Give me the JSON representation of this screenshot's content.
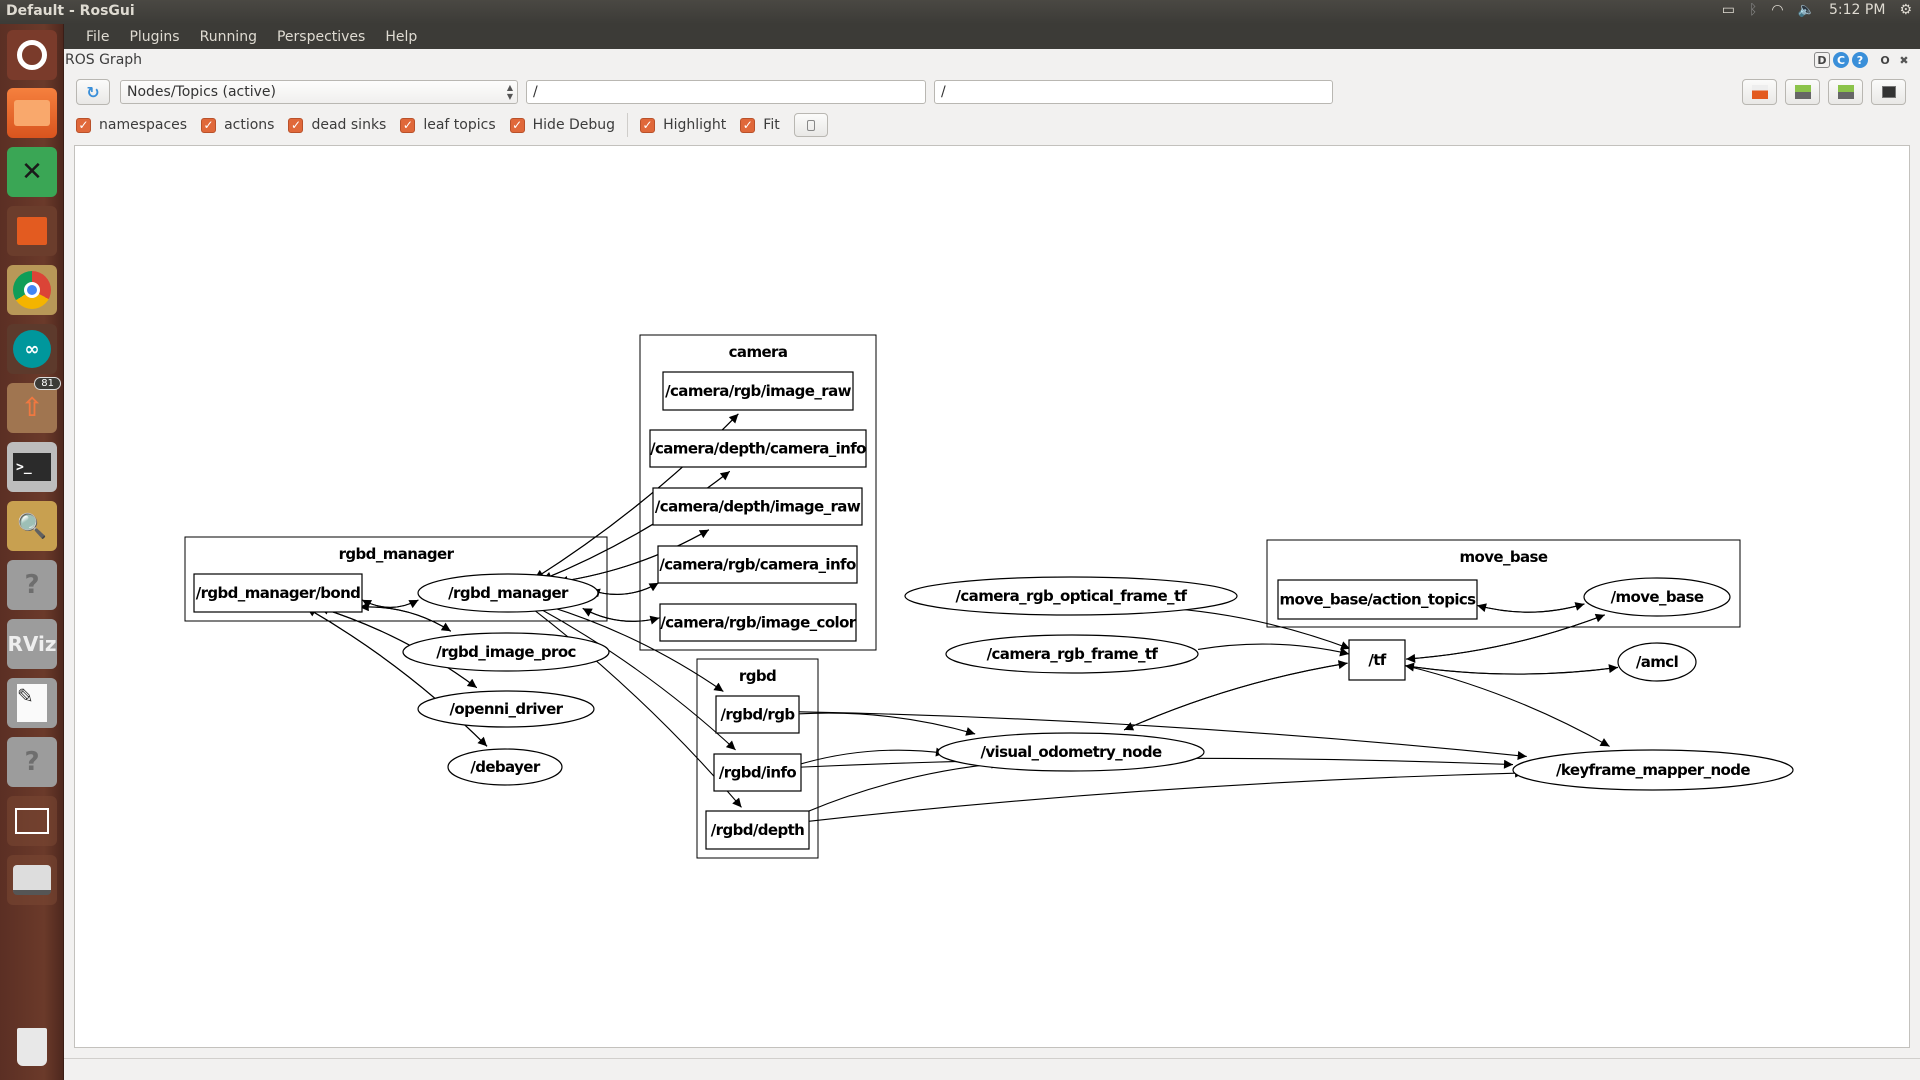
{
  "window": {
    "title": "Default - RosGui"
  },
  "tray": {
    "battery_icon": "battery-charging-icon",
    "bluetooth_icon": "bluetooth-icon",
    "wifi_icon": "wifi-icon",
    "volume_icon": "volume-icon",
    "time": "5:12 PM",
    "power_icon": "power-gear-icon"
  },
  "menu": {
    "items": [
      "File",
      "Plugins",
      "Running",
      "Perspectives",
      "Help"
    ]
  },
  "launcher": {
    "items": [
      {
        "name": "ubuntu-dash",
        "icon": "ubuntu-logo-icon"
      },
      {
        "name": "files",
        "icon": "folder-icon"
      },
      {
        "name": "system-tools",
        "icon": "tools-icon"
      },
      {
        "name": "software-center",
        "icon": "shopping-bag-icon"
      },
      {
        "name": "chrome",
        "icon": "chrome-icon"
      },
      {
        "name": "arduino",
        "icon": "arduino-icon"
      },
      {
        "name": "software-updater",
        "icon": "update-box-icon",
        "badge": "81"
      },
      {
        "name": "terminal",
        "icon": "terminal-icon"
      },
      {
        "name": "image-viewer",
        "icon": "image-viewer-icon"
      },
      {
        "name": "unknown-app-1",
        "icon": "question-icon"
      },
      {
        "name": "rviz",
        "icon": "rviz-icon",
        "label": "RViz"
      },
      {
        "name": "text-editor",
        "icon": "text-editor-icon"
      },
      {
        "name": "unknown-app-2",
        "icon": "question-icon"
      },
      {
        "name": "workspace-switcher",
        "icon": "workspace-icon"
      },
      {
        "name": "drive",
        "icon": "hard-drive-icon"
      },
      {
        "name": "trash",
        "icon": "trash-icon"
      }
    ]
  },
  "plugin": {
    "title": "ROS Graph",
    "controls": [
      "D",
      "C",
      "?",
      "O",
      "✖"
    ]
  },
  "toolbar": {
    "graph_type": "Nodes/Topics (active)",
    "node_filter": "/",
    "topic_filter": "/",
    "right_buttons": [
      "load-dot-icon",
      "save-dot-icon",
      "save-svg-icon",
      "save-image-icon"
    ]
  },
  "options": [
    {
      "label": "namespaces",
      "checked": true
    },
    {
      "label": "actions",
      "checked": true
    },
    {
      "label": "dead sinks",
      "checked": true
    },
    {
      "label": "leaf topics",
      "checked": true
    },
    {
      "label": "Hide Debug",
      "checked": true
    },
    {
      "label": "Highlight",
      "checked": true
    },
    {
      "label": "Fit",
      "checked": true
    }
  ],
  "graph": {
    "clusters": [
      {
        "id": "rgbd_manager",
        "label": "rgbd_manager"
      },
      {
        "id": "camera",
        "label": "camera"
      },
      {
        "id": "rgbd",
        "label": "rgbd"
      },
      {
        "id": "move_base",
        "label": "move_base"
      }
    ],
    "topics": [
      {
        "id": "bond",
        "label": "/rgbd_manager/bond"
      },
      {
        "id": "img_raw",
        "label": "/camera/rgb/image_raw"
      },
      {
        "id": "depth_info",
        "label": "/camera/depth/camera_info"
      },
      {
        "id": "depth_raw",
        "label": "/camera/depth/image_raw"
      },
      {
        "id": "rgb_info",
        "label": "/camera/rgb/camera_info"
      },
      {
        "id": "img_color",
        "label": "/camera/rgb/image_color"
      },
      {
        "id": "rgbd_rgb",
        "label": "/rgbd/rgb"
      },
      {
        "id": "rgbd_info",
        "label": "/rgbd/info"
      },
      {
        "id": "rgbd_depth",
        "label": "/rgbd/depth"
      },
      {
        "id": "action_topics",
        "label": "move_base/action_topics"
      },
      {
        "id": "tf",
        "label": "/tf"
      }
    ],
    "nodes": [
      {
        "id": "rgbd_manager_n",
        "label": "/rgbd_manager"
      },
      {
        "id": "image_proc",
        "label": "/rgbd_image_proc"
      },
      {
        "id": "openni",
        "label": "/openni_driver"
      },
      {
        "id": "debayer",
        "label": "/debayer"
      },
      {
        "id": "optical_tf",
        "label": "/camera_rgb_optical_frame_tf"
      },
      {
        "id": "frame_tf",
        "label": "/camera_rgb_frame_tf"
      },
      {
        "id": "vo",
        "label": "/visual_odometry_node"
      },
      {
        "id": "move_base_n",
        "label": "/move_base"
      },
      {
        "id": "amcl",
        "label": "/amcl"
      },
      {
        "id": "kfm",
        "label": "/keyframe_mapper_node"
      }
    ],
    "edges": [
      [
        "rgbd_manager_n",
        "bond"
      ],
      [
        "bond",
        "rgbd_manager_n"
      ],
      [
        "bond",
        "image_proc"
      ],
      [
        "image_proc",
        "bond"
      ],
      [
        "bond",
        "openni"
      ],
      [
        "openni",
        "bond"
      ],
      [
        "bond",
        "debayer"
      ],
      [
        "debayer",
        "bond"
      ],
      [
        "img_raw",
        "rgbd_manager_n"
      ],
      [
        "rgbd_manager_n",
        "img_raw"
      ],
      [
        "depth_info",
        "rgbd_manager_n"
      ],
      [
        "rgbd_manager_n",
        "depth_info"
      ],
      [
        "depth_raw",
        "rgbd_manager_n"
      ],
      [
        "rgbd_manager_n",
        "depth_raw"
      ],
      [
        "rgb_info",
        "rgbd_manager_n"
      ],
      [
        "rgbd_manager_n",
        "rgb_info"
      ],
      [
        "img_color",
        "rgbd_manager_n"
      ],
      [
        "rgbd_manager_n",
        "img_color"
      ],
      [
        "rgbd_manager_n",
        "rgbd_rgb"
      ],
      [
        "rgbd_manager_n",
        "rgbd_info"
      ],
      [
        "rgbd_manager_n",
        "rgbd_depth"
      ],
      [
        "rgbd_rgb",
        "vo"
      ],
      [
        "rgbd_info",
        "vo"
      ],
      [
        "rgbd_depth",
        "vo"
      ],
      [
        "rgbd_rgb",
        "kfm"
      ],
      [
        "rgbd_info",
        "kfm"
      ],
      [
        "rgbd_depth",
        "kfm"
      ],
      [
        "optical_tf",
        "tf"
      ],
      [
        "frame_tf",
        "tf"
      ],
      [
        "vo",
        "tf"
      ],
      [
        "tf",
        "vo"
      ],
      [
        "move_base_n",
        "tf"
      ],
      [
        "tf",
        "move_base_n"
      ],
      [
        "amcl",
        "tf"
      ],
      [
        "tf",
        "amcl"
      ],
      [
        "tf",
        "kfm"
      ],
      [
        "move_base_n",
        "action_topics"
      ],
      [
        "action_topics",
        "move_base_n"
      ]
    ]
  }
}
